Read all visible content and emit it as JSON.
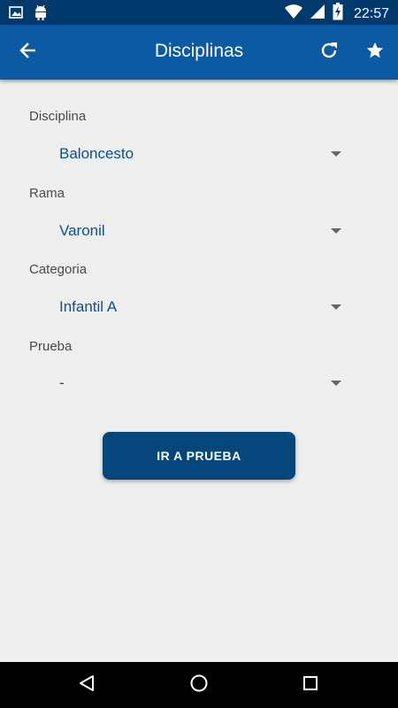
{
  "status_bar": {
    "time": "22:57",
    "icons": [
      "image-icon",
      "android-icon",
      "wifi-icon",
      "signal-icon",
      "battery-charging-icon"
    ]
  },
  "app_bar": {
    "title": "Disciplinas",
    "back_icon": "arrow-back-icon",
    "refresh_icon": "refresh-icon",
    "favorite_icon": "star-icon"
  },
  "form": {
    "fields": [
      {
        "label": "Disciplina",
        "value": "Baloncesto"
      },
      {
        "label": "Rama",
        "value": "Varonil"
      },
      {
        "label": "Categoria",
        "value": "Infantil A"
      },
      {
        "label": "Prueba",
        "value": "-"
      }
    ],
    "button_label": "IR A PRUEBA"
  },
  "colors": {
    "status_bar": "#003a6c",
    "app_bar": "#0b5aa2",
    "button": "#05467d",
    "value_text": "#0b4f94",
    "background": "#eeeeee"
  },
  "nav_bar": {
    "icons": [
      "back-triangle-icon",
      "home-circle-icon",
      "recents-square-icon"
    ]
  }
}
